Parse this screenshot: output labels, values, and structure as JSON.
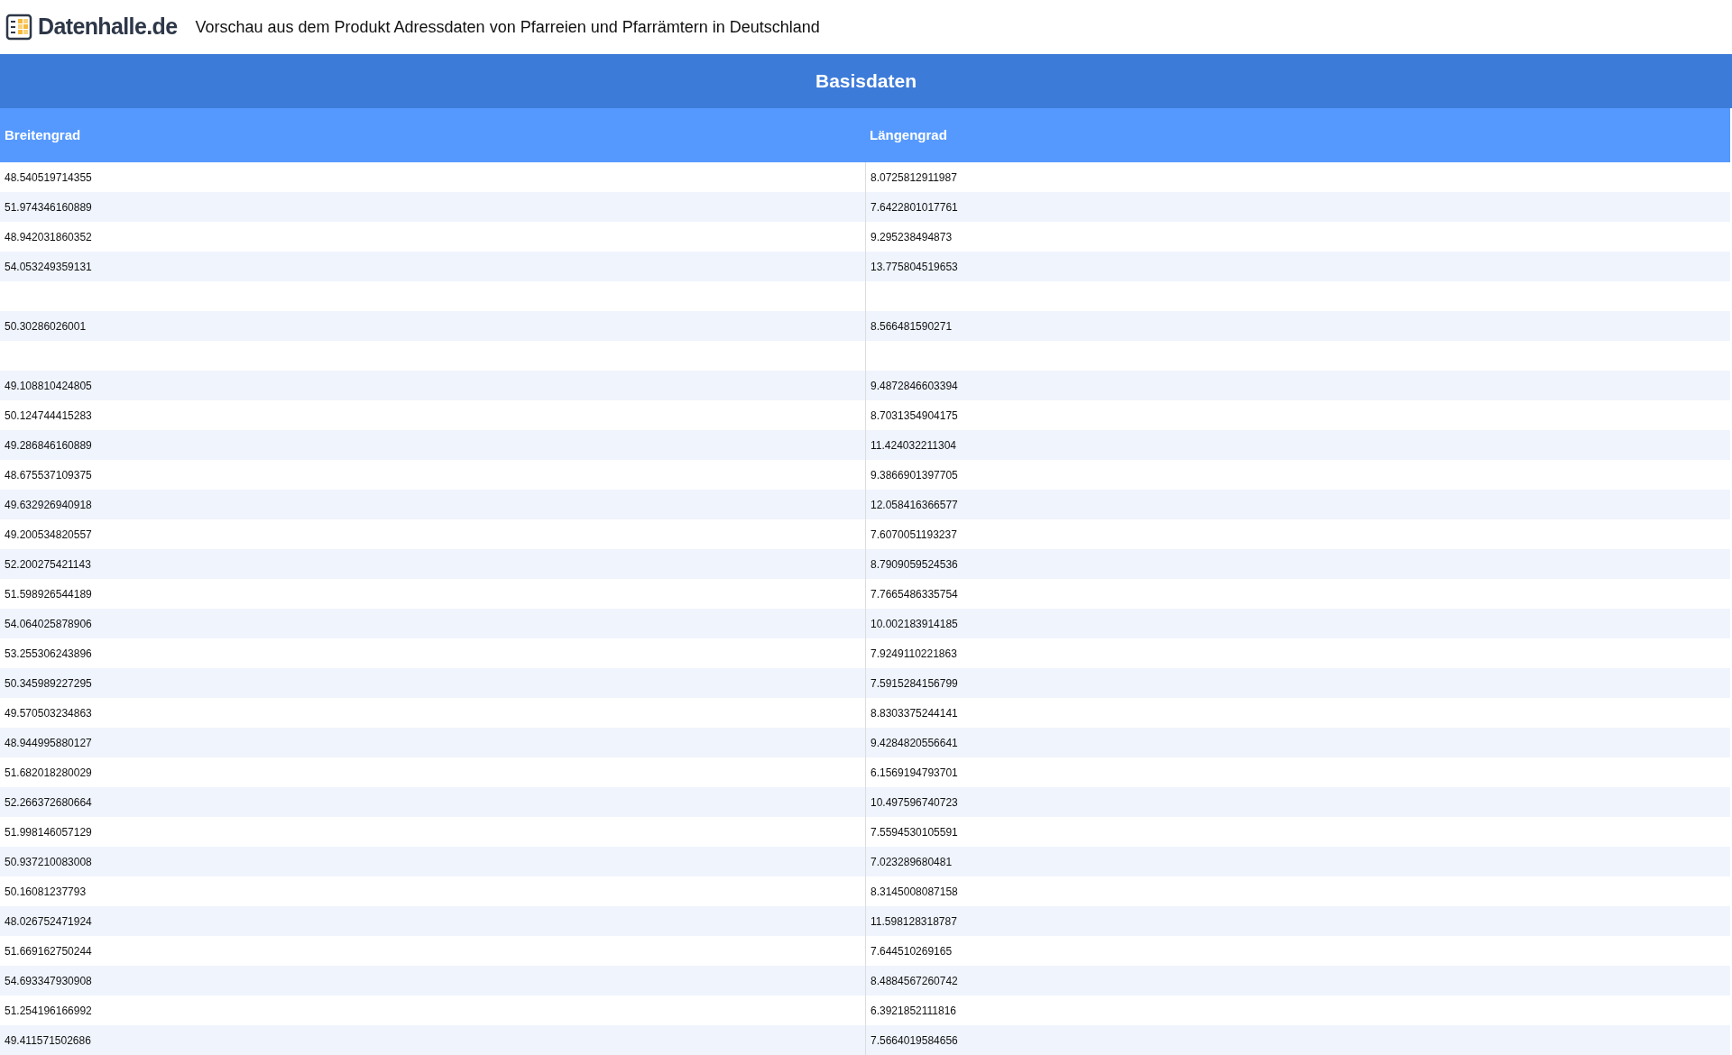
{
  "header": {
    "logo_text": "Datenhalle.de",
    "title": "Vorschau aus dem Produkt Adressdaten von Pfarreien und Pfarrämtern in Deutschland"
  },
  "table": {
    "caption": "Basisdaten",
    "columns": [
      "Breitengrad",
      "Längengrad"
    ],
    "rows": [
      {
        "cells": [
          "48.540519714355",
          "8.0725812911987"
        ]
      },
      {
        "cells": [
          "51.974346160889",
          "7.6422801017761"
        ]
      },
      {
        "cells": [
          "48.942031860352",
          "9.295238494873"
        ]
      },
      {
        "cells": [
          "54.053249359131",
          "13.775804519653"
        ]
      },
      {},
      {
        "cells": [
          "50.30286026001",
          "8.566481590271"
        ]
      },
      {},
      {
        "cells": [
          "49.108810424805",
          "9.4872846603394"
        ]
      },
      {
        "cells": [
          "50.124744415283",
          "8.7031354904175"
        ]
      },
      {
        "cells": [
          "49.286846160889",
          "11.424032211304"
        ]
      },
      {
        "cells": [
          "48.675537109375",
          "9.3866901397705"
        ]
      },
      {
        "cells": [
          "49.632926940918",
          "12.058416366577"
        ]
      },
      {
        "cells": [
          "49.200534820557",
          "7.6070051193237"
        ]
      },
      {
        "cells": [
          "52.200275421143",
          "8.7909059524536"
        ]
      },
      {
        "cells": [
          "51.598926544189",
          "7.7665486335754"
        ]
      },
      {
        "cells": [
          "54.064025878906",
          "10.002183914185"
        ]
      },
      {
        "cells": [
          "53.255306243896",
          "7.9249110221863"
        ]
      },
      {
        "cells": [
          "50.345989227295",
          "7.5915284156799"
        ]
      },
      {
        "cells": [
          "49.570503234863",
          "8.8303375244141"
        ]
      },
      {
        "cells": [
          "48.944995880127",
          "9.4284820556641"
        ]
      },
      {
        "cells": [
          "51.682018280029",
          "6.1569194793701"
        ]
      },
      {
        "cells": [
          "52.266372680664",
          "10.497596740723"
        ]
      },
      {
        "cells": [
          "51.998146057129",
          "7.5594530105591"
        ]
      },
      {
        "cells": [
          "50.937210083008",
          "7.023289680481"
        ]
      },
      {
        "cells": [
          "50.16081237793",
          "8.3145008087158"
        ]
      },
      {
        "cells": [
          "48.026752471924",
          "11.598128318787"
        ]
      },
      {
        "cells": [
          "51.669162750244",
          "7.644510269165"
        ]
      },
      {
        "cells": [
          "54.693347930908",
          "8.4884567260742"
        ]
      },
      {
        "cells": [
          "51.254196166992",
          "6.3921852111816"
        ]
      },
      {
        "cells": [
          "49.411571502686",
          "7.5664019584656"
        ]
      }
    ]
  }
}
